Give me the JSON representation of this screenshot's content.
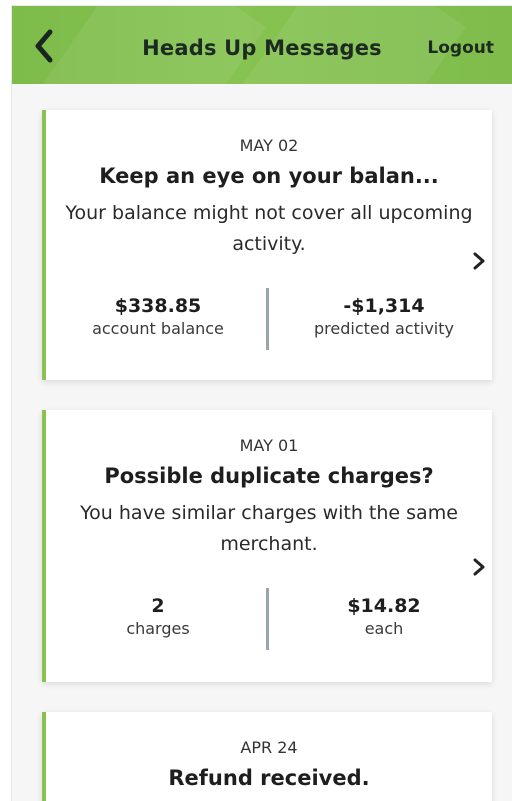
{
  "header": {
    "title": "Heads Up Messages",
    "logout_label": "Logout"
  },
  "messages": [
    {
      "date": "MAY 02",
      "title": "Keep an eye on your balan...",
      "description": "Your balance might not cover all upcoming activity.",
      "stats": [
        {
          "value": "$338.85",
          "label": "account balance"
        },
        {
          "value": "-$1,314",
          "label": "predicted activity"
        }
      ]
    },
    {
      "date": "MAY 01",
      "title": "Possible duplicate charges?",
      "description": "You have similar charges with the same merchant.",
      "stats": [
        {
          "value": "2",
          "label": "charges"
        },
        {
          "value": "$14.82",
          "label": "each"
        }
      ]
    },
    {
      "date": "APR 24",
      "title": "Refund received."
    }
  ],
  "colors": {
    "header_green": "#84c04f",
    "card_accent": "#8cc152",
    "divider": "#9aa4ad"
  },
  "icons": {
    "back": "chevron-left-icon",
    "open": "chevron-right-icon"
  }
}
